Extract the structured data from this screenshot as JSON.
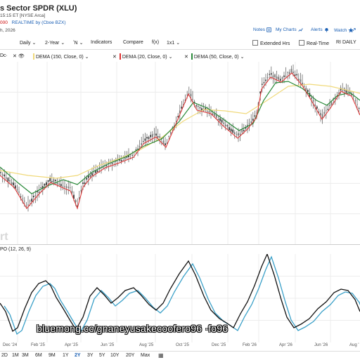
{
  "header": {
    "title": "s Sector SPDR (XLU)",
    "quote_line": "15:15 ET [NYSE Arca]",
    "price": "000",
    "realtime": "REALTIME by (Cboe BZX)",
    "date": "h, 2026",
    "links": [
      {
        "label": "Notes",
        "icon": "note-icon"
      },
      {
        "label": "My Charts",
        "icon": "chart-icon"
      },
      {
        "label": "Alerts",
        "icon": "bell-icon"
      },
      {
        "label": "Watch",
        "icon": "star-icon"
      }
    ]
  },
  "toolbar": {
    "interval": "Daily",
    "range": "2-Year",
    "type": "ʼN",
    "indicators": "Indicators",
    "compare": "Compare",
    "fx": "f(x)",
    "layout": "1x1",
    "extended_hours": "Extended Hrs",
    "real_time": "Real-Time",
    "right_label": "RI DAILY"
  },
  "legend": {
    "prefix": "Dc·",
    "items": [
      {
        "label": "DEMA (150, Close, 0)",
        "color": "#f0d97a"
      },
      {
        "label": "DEMA (20, Close, 0)",
        "color": "#e03030"
      },
      {
        "label": "DEMA (50, Close, 0)",
        "color": "#2a8a3a"
      }
    ]
  },
  "ppo_label": "PO (12, 26, 9)",
  "watermark": "rt",
  "x_axis": [
    "Dec '24",
    "Feb '25",
    "Apr '25",
    "Jun '25",
    "Aug '25",
    "Oct '25",
    "Dec '25",
    "Feb '26",
    "Apr '26",
    "Jun '26",
    "Aug '"
  ],
  "ranges": [
    "2D",
    "1M",
    "3M",
    "6M",
    "9M",
    "1Y",
    "2Y",
    "3Y",
    "5Y",
    "10Y",
    "20Y",
    "Max"
  ],
  "active_range": "2Y",
  "overlay_text": "bluemong.cc/gnaneyusakecoofero96 ·fo96",
  "colors": {
    "accent": "#1a5fb4",
    "dema150": "#f0d97a",
    "dema20": "#e03030",
    "dema50": "#2a8a3a",
    "ppo": "#111111",
    "ppo_signal": "#3aa0c8"
  }
}
